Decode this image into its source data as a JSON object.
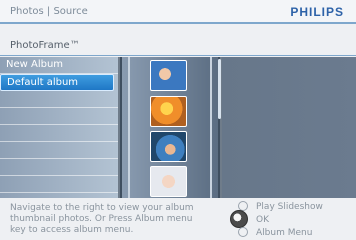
{
  "header": {
    "breadcrumb": "Photos | Source",
    "brand": "PHILIPS"
  },
  "device": {
    "title": "PhotoFrame™"
  },
  "albums": [
    {
      "label": "New Album",
      "selected": false
    },
    {
      "label": "Default album",
      "selected": true
    },
    {
      "label": "",
      "selected": false
    },
    {
      "label": "",
      "selected": false
    },
    {
      "label": "",
      "selected": false
    },
    {
      "label": "",
      "selected": false
    },
    {
      "label": "",
      "selected": false
    },
    {
      "label": "",
      "selected": false
    }
  ],
  "help": {
    "text": "Navigate to the right to view your album thumbnail photos. Or Press Album menu key to access album menu."
  },
  "controls": {
    "play_slideshow": "Play Slideshow",
    "ok": "OK",
    "album_menu": "Album Menu"
  },
  "colors": {
    "accent": "#2d62a8",
    "selected": "#1f77c5",
    "divider": "#7ea7cc"
  }
}
